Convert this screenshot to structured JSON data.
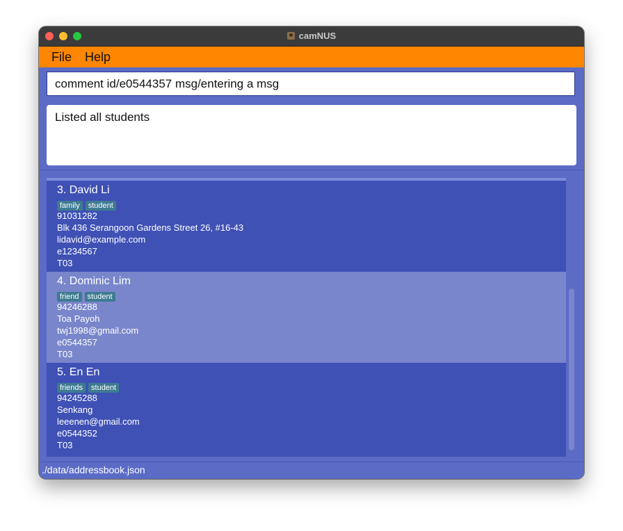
{
  "window": {
    "title": "camNUS"
  },
  "menu": {
    "file": "File",
    "help": "Help"
  },
  "command": {
    "value": "comment id/e0544357 msg/entering a msg"
  },
  "result": {
    "text": "Listed all students"
  },
  "persons": [
    {
      "index_name": "3.  David Li",
      "tags": [
        "family",
        "student"
      ],
      "phone": "91031282",
      "address": "Blk 436 Serangoon Gardens Street 26, #16-43",
      "email": "lidavid@example.com",
      "student_id": "e1234567",
      "tutorial": "T03"
    },
    {
      "index_name": "4.  Dominic Lim",
      "tags": [
        "friend",
        "student"
      ],
      "phone": "94246288",
      "address": "Toa Payoh",
      "email": "twj1998@gmail.com",
      "student_id": "e0544357",
      "tutorial": "T03"
    },
    {
      "index_name": "5.  En En",
      "tags": [
        "friends",
        "student"
      ],
      "phone": "94245288",
      "address": "Senkang",
      "email": "leeenen@gmail.com",
      "student_id": "e0544352",
      "tutorial": "T03"
    }
  ],
  "status": {
    "path": "./data/addressbook.json"
  },
  "colors": {
    "menubar": "#fe8601",
    "panel": "#5b6bc6",
    "card": "#3f51b5",
    "card_selected": "#7986cb",
    "tag": "#3e7b91"
  }
}
